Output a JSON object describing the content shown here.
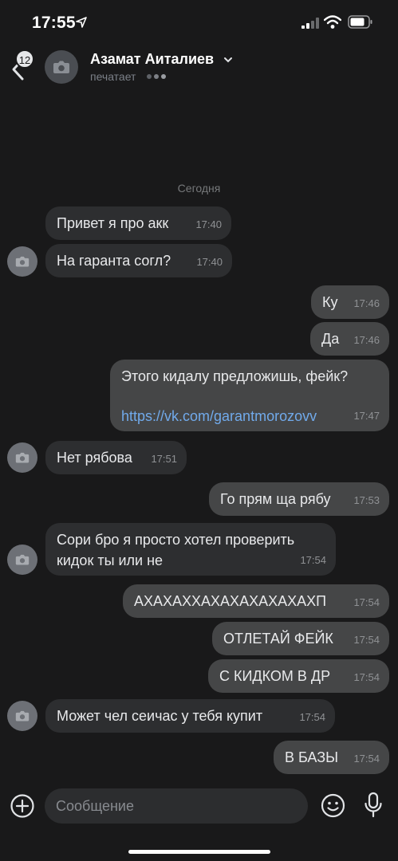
{
  "status_bar": {
    "time": "17:55"
  },
  "header": {
    "back_badge": "12",
    "name": "Азамат Аиталиев",
    "status": "печатает"
  },
  "date_separator": "Сегодня",
  "messages": [
    {
      "dir": "in",
      "text": "Привет я про акк",
      "time": "17:40"
    },
    {
      "dir": "in",
      "text": "На гаранта согл?",
      "time": "17:40"
    },
    {
      "dir": "out",
      "text": "Ку",
      "time": "17:46"
    },
    {
      "dir": "out",
      "text": "Да",
      "time": "17:46"
    },
    {
      "dir": "out",
      "text": "Этого кидалу предложишь, фейк?",
      "link": "https://vk.com/garantmorozovv",
      "time": "17:47"
    },
    {
      "dir": "in",
      "text": "Нет рябова",
      "time": "17:51"
    },
    {
      "dir": "out",
      "text": "Го прям ща рябу",
      "time": "17:53"
    },
    {
      "dir": "in",
      "text_line1": "Сори бро я просто хотел проверить",
      "text_line2": "кидок ты или не",
      "time": "17:54"
    },
    {
      "dir": "out",
      "text": "АХАХАХХАХАХАХАХАХАХП",
      "time": "17:54"
    },
    {
      "dir": "out",
      "text": "ОТЛЕТАЙ ФЕЙК",
      "time": "17:54"
    },
    {
      "dir": "out",
      "text": "С КИДКОМ В ДР",
      "time": "17:54"
    },
    {
      "dir": "in",
      "text": "Может чел сеичас у тебя купит",
      "time": "17:54"
    },
    {
      "dir": "out",
      "text": "В БАЗЫ",
      "time": "17:54"
    }
  ],
  "composer": {
    "placeholder": "Сообщение"
  },
  "icons": [
    "location-arrow-icon",
    "signal-icon",
    "wifi-icon",
    "battery-icon",
    "back-chevron-icon",
    "camera-icon",
    "chevron-down-icon",
    "plus-icon",
    "emoji-icon",
    "microphone-icon"
  ],
  "colors": {
    "background": "#19191a",
    "incoming_bubble": "#2d2e30",
    "outgoing_bubble": "#454647",
    "link": "#71aaeb"
  }
}
